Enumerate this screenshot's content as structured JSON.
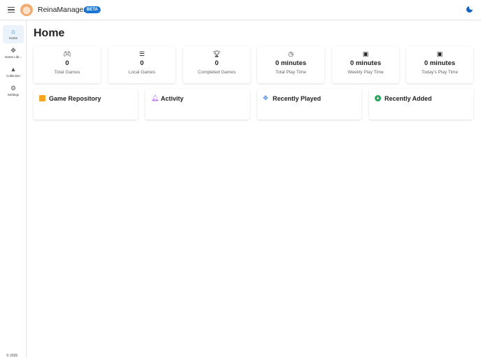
{
  "header": {
    "app_title": "ReinaManager",
    "badge": "BETA"
  },
  "sidebar": {
    "items": [
      {
        "label": "Home"
      },
      {
        "label": "Game Libr..."
      },
      {
        "label": "Collection"
      },
      {
        "label": "Settings"
      }
    ],
    "copyright": "© 2026"
  },
  "main": {
    "title": "Home",
    "stats": [
      {
        "value": "0",
        "label": "Total Games",
        "icon": "gamepad-icon"
      },
      {
        "value": "0",
        "label": "Local Games",
        "icon": "list-icon"
      },
      {
        "value": "0",
        "label": "Completed Games",
        "icon": "trophy-icon"
      },
      {
        "value": "0 minutes",
        "label": "Total Play Time",
        "icon": "clock-icon"
      },
      {
        "value": "0 minutes",
        "label": "Weekly Play Time",
        "icon": "calendar-icon"
      },
      {
        "value": "0 minutes",
        "label": "Today's Play Time",
        "icon": "calendar-today-icon"
      }
    ],
    "panels": [
      {
        "title": "Game Repository",
        "icon": "archive-icon",
        "color": "#f5a623"
      },
      {
        "title": "Activity",
        "icon": "bell-icon",
        "color": "#a855f7"
      },
      {
        "title": "Recently Played",
        "icon": "gamepad-cross-icon",
        "color": "#3b82f6"
      },
      {
        "title": "Recently Added",
        "icon": "add-circle-icon",
        "color": "#22a559"
      }
    ]
  },
  "colors": {
    "accent": "#1976d2"
  }
}
